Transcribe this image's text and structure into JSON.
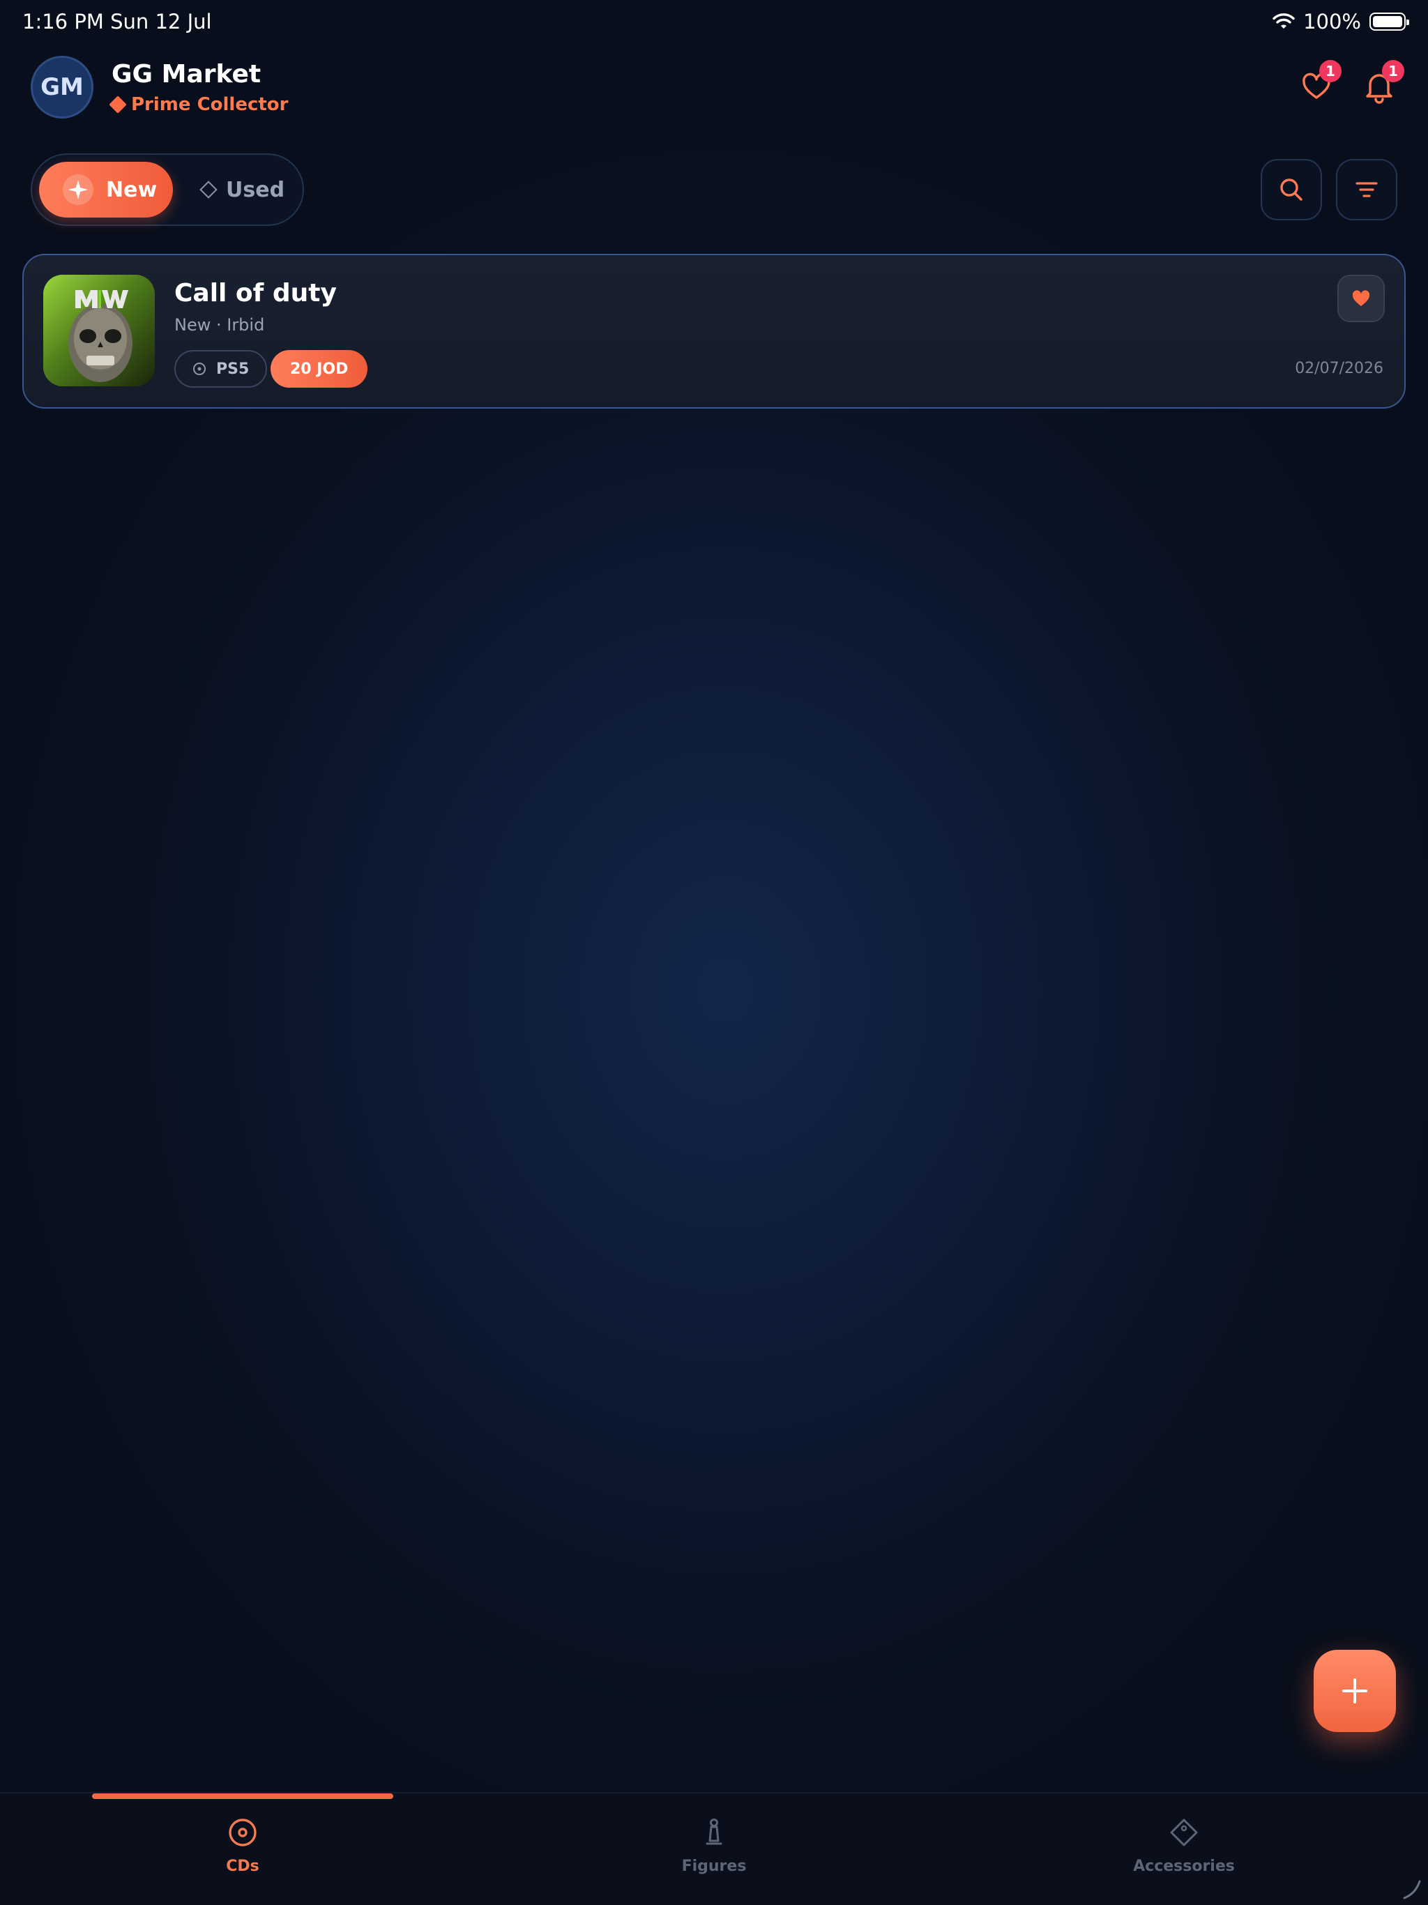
{
  "status_bar": {
    "time": "1:16 PM   Sun 12 Jul",
    "battery": "100%"
  },
  "header": {
    "avatar_initials": "GM",
    "app_name": "GG Market",
    "tier": "Prime Collector",
    "favorites_badge": "1",
    "notifications_badge": "1"
  },
  "segment": {
    "new_label": "New",
    "used_label": "Used",
    "selected": "New"
  },
  "listing": {
    "title": "Call of duty",
    "subtitle": "New · Irbid",
    "platform": "PS5",
    "price": "20 JOD",
    "date": "02/07/2026",
    "favorited": true
  },
  "bottom_nav": {
    "tabs": [
      {
        "label": "CDs",
        "icon": "disc-icon",
        "active": true
      },
      {
        "label": "Figures",
        "icon": "figure-icon",
        "active": false
      },
      {
        "label": "Accessories",
        "icon": "tag-icon",
        "active": false
      }
    ]
  },
  "colors": {
    "accent": "#f26a45",
    "badge": "#f0375e",
    "background": "#0a1324"
  }
}
